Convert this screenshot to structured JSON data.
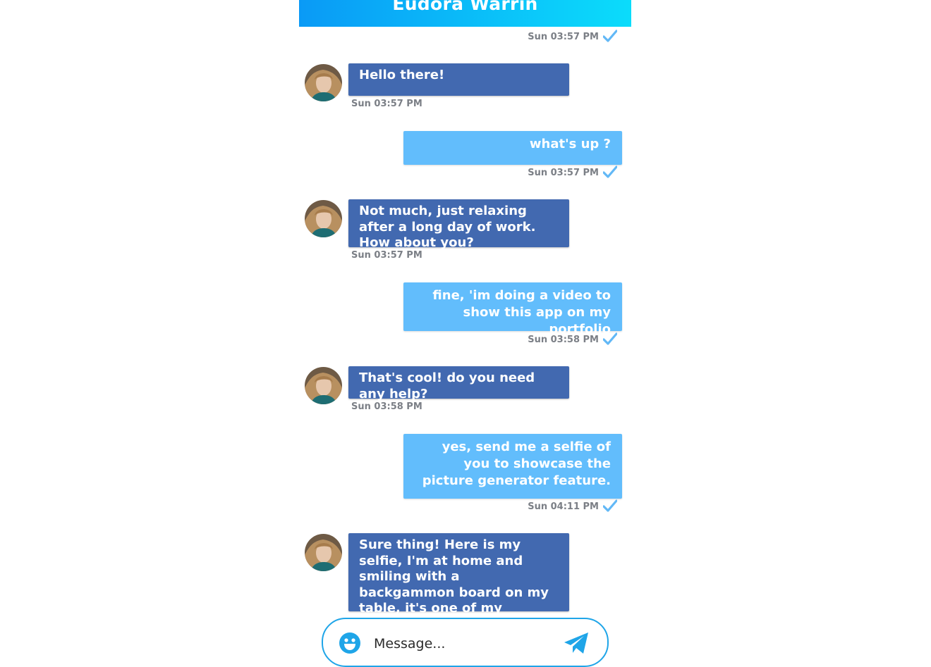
{
  "header": {
    "title": "Eudora Warrin"
  },
  "messages": [
    {
      "side": "out",
      "text": "",
      "time": "Sun 03:57 PM"
    },
    {
      "side": "in",
      "text": "Hello there!",
      "time": "Sun 03:57 PM"
    },
    {
      "side": "out",
      "text": "what's up ?",
      "time": "Sun 03:57 PM"
    },
    {
      "side": "in",
      "text": "Not much, just relaxing after a long day of work. How about you?",
      "time": "Sun 03:57 PM"
    },
    {
      "side": "out",
      "text": "fine, 'im doing a video to show this app on my portfolio",
      "time": "Sun 03:58 PM"
    },
    {
      "side": "in",
      "text": "That's cool! do you need any help?",
      "time": "Sun 03:58 PM"
    },
    {
      "side": "out",
      "text": "yes, send me a selfie of you to showcase the picture generator feature.",
      "time": "Sun 04:11 PM"
    },
    {
      "side": "in",
      "text": "Sure thing! Here is my selfie, I'm at home and smiling with a backgammon board on my table, it's one of my favourite games.",
      "time": ""
    }
  ],
  "composer": {
    "placeholder": "Message...",
    "emoji_icon": "smiley-icon",
    "send_icon": "paper-plane-icon"
  },
  "colors": {
    "header_start": "#0a9af6",
    "header_end": "#0bdcfb",
    "incoming_bubble": "#4269b0",
    "outgoing_bubble": "#62bdfc",
    "read_check": "#62b8f6",
    "composer_border": "#1fa5e8"
  }
}
